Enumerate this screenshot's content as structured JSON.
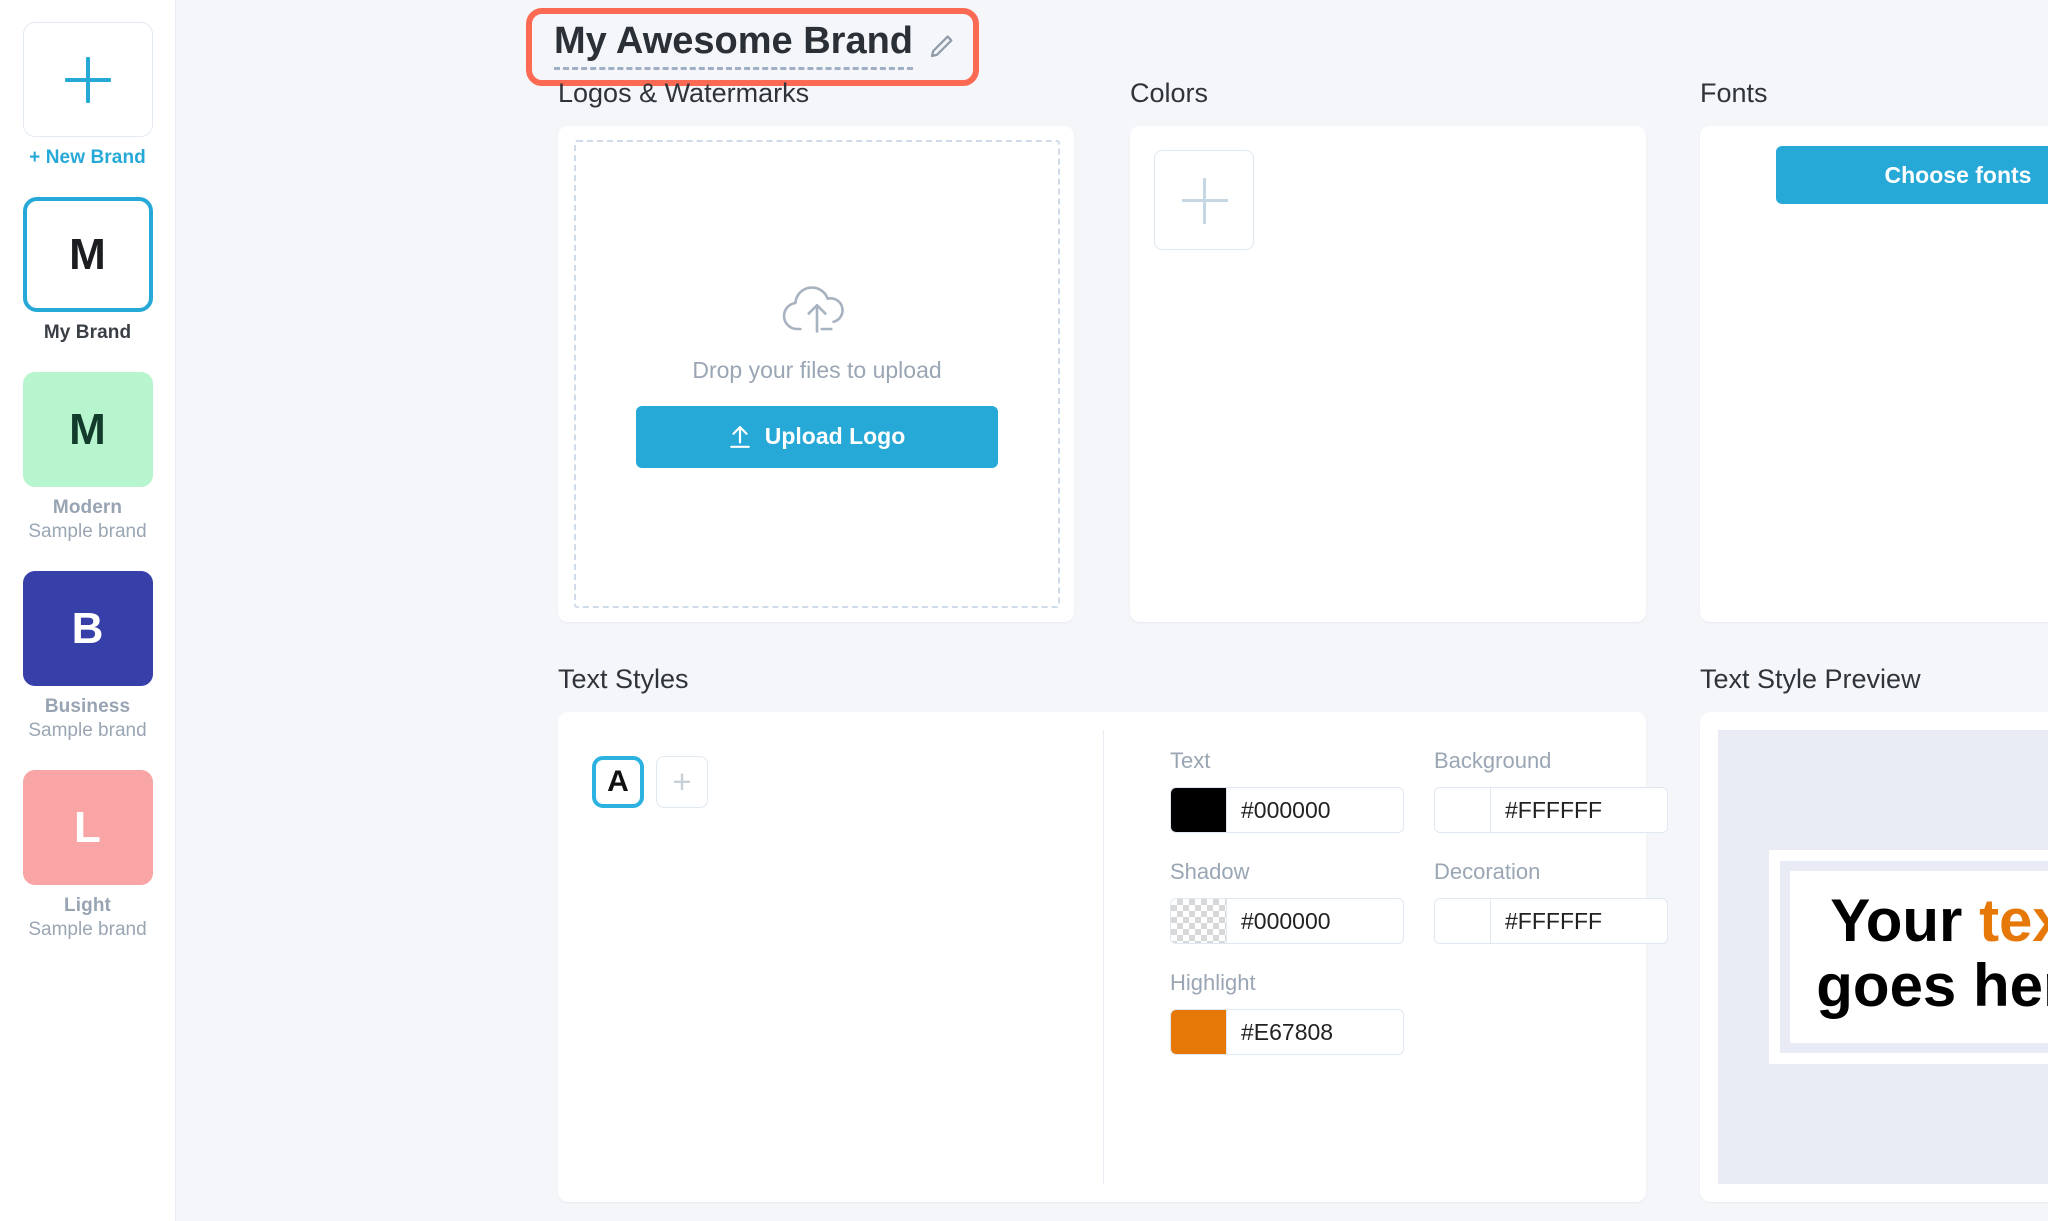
{
  "sidebar": {
    "items": [
      {
        "name": "new-brand",
        "glyph": "+",
        "label": "+ New Brand",
        "sub": "",
        "bg": "#ffffff",
        "fg": "#27a9d8"
      },
      {
        "name": "my-brand",
        "glyph": "M",
        "label": "My Brand",
        "sub": "",
        "bg": "#ffffff",
        "fg": "#1b1d20"
      },
      {
        "name": "modern",
        "glyph": "M",
        "label": "Modern",
        "sub": "Sample brand",
        "bg": "#b7f5cf",
        "fg": "#123b2c"
      },
      {
        "name": "business",
        "glyph": "B",
        "label": "Business",
        "sub": "Sample brand",
        "bg": "#3640a8",
        "fg": "#ffffff"
      },
      {
        "name": "light",
        "glyph": "L",
        "label": "Light",
        "sub": "Sample brand",
        "bg": "#f9a5a5",
        "fg": "#ffffff"
      }
    ]
  },
  "header": {
    "brand_title": "My Awesome Brand",
    "edit_icon": "pencil-icon",
    "highlight_color": "#fc6a53"
  },
  "logos": {
    "section_title": "Logos & Watermarks",
    "drop_text": "Drop your files to upload",
    "upload_button": "Upload Logo",
    "upload_icon": "upload-arrow-icon",
    "cloud_icon": "cloud-upload-icon"
  },
  "colors": {
    "section_title": "Colors",
    "add_icon": "plus-icon"
  },
  "fonts": {
    "section_title": "Fonts",
    "choose_button": "Choose fonts"
  },
  "text_styles": {
    "section_title": "Text Styles",
    "chips": [
      {
        "name": "style-a",
        "glyph": "A",
        "selected": true
      },
      {
        "name": "add-style",
        "glyph": "+",
        "selected": false
      }
    ],
    "fields": [
      {
        "name": "text",
        "label": "Text",
        "value": "#000000",
        "swatch": "#000000",
        "transparent": false
      },
      {
        "name": "background",
        "label": "Background",
        "value": "#FFFFFF",
        "swatch": "#FFFFFF",
        "transparent": false
      },
      {
        "name": "shadow",
        "label": "Shadow",
        "value": "#000000",
        "swatch": "#000000",
        "transparent": true
      },
      {
        "name": "decoration",
        "label": "Decoration",
        "value": "#FFFFFF",
        "swatch": "#FFFFFF",
        "transparent": false
      },
      {
        "name": "highlight",
        "label": "Highlight",
        "value": "#E67808",
        "swatch": "#E67808",
        "transparent": false
      }
    ]
  },
  "preview": {
    "section_title": "Text Style Preview",
    "line1_plain": "Your ",
    "line1_highlight": "text",
    "line2": "goes here",
    "highlight_color": "#e67808",
    "stage_bg": "#e8ebf4"
  },
  "theme": {
    "accent": "#27a9d8",
    "page_bg": "#f4f6fa",
    "card_bg": "#ffffff"
  }
}
